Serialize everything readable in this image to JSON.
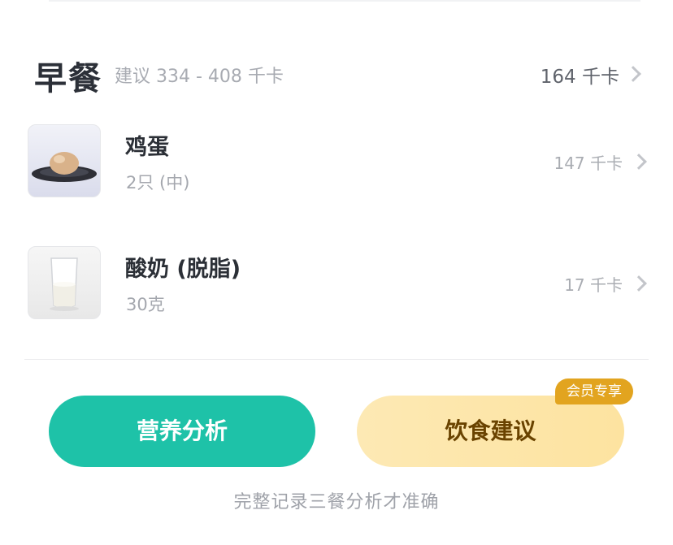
{
  "meal": {
    "title": "早餐",
    "suggestion": "建议 334 - 408 千卡",
    "total": "164 千卡"
  },
  "foods": [
    {
      "name": "鸡蛋",
      "portion": "2只 (中)",
      "kcal": "147 千卡",
      "icon": "egg-on-plate-image"
    },
    {
      "name": "酸奶 (脱脂)",
      "portion": "30克",
      "kcal": "17 千卡",
      "icon": "glass-of-yogurt-image"
    }
  ],
  "actions": {
    "analysis_label": "营养分析",
    "advice_label": "饮食建议",
    "vip_badge": "会员专享"
  },
  "footer_hint": "完整记录三餐分析才准确",
  "colors": {
    "accent_green": "#1ec2a8",
    "advice_yellow": "#fde6a8",
    "vip_orange": "#e2a41f"
  }
}
